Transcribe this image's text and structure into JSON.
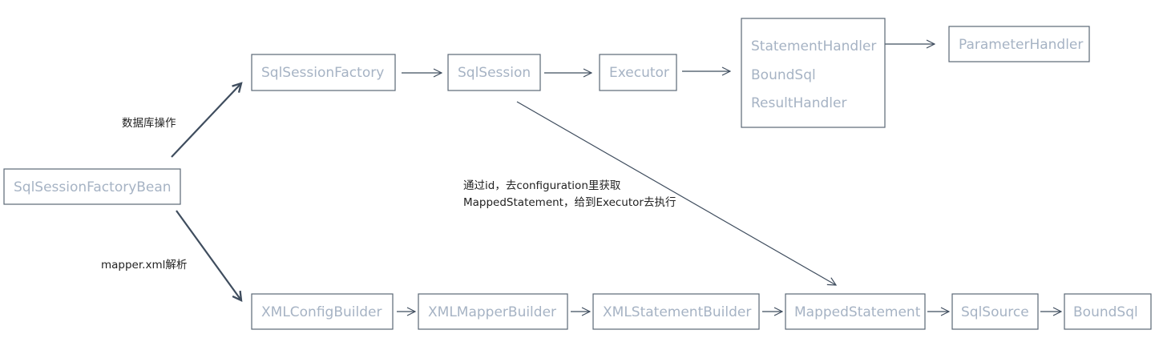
{
  "diagram": {
    "nodes": {
      "factory_bean": "SqlSessionFactoryBean",
      "session_factory": "SqlSessionFactory",
      "session": "SqlSession",
      "executor": "Executor",
      "handler_group": [
        "StatementHandler",
        "BoundSql",
        "ResultHandler"
      ],
      "parameter_handler": "ParameterHandler",
      "config_builder": "XMLConfigBuilder",
      "mapper_builder": "XMLMapperBuilder",
      "statement_builder": "XMLStatementBuilder",
      "mapped_statement": "MappedStatement",
      "sql_source": "SqlSource",
      "bound_sql": "BoundSql"
    },
    "edge_labels": {
      "db_operation": "数据库操作",
      "mapper_parse": "mapper.xml解析",
      "lookup_note": [
        "通过id，去configuration里获取",
        "MappedStatement，给到Executor去执行"
      ]
    },
    "colors": {
      "border": "#5b6776",
      "label": "#a6b3c4",
      "arrow": "#3f4d5e",
      "note": "#222222"
    }
  }
}
